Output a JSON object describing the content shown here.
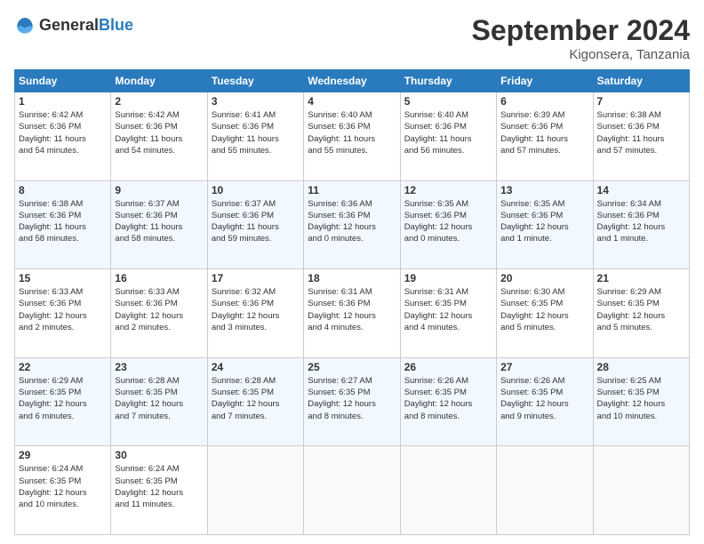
{
  "logo": {
    "general": "General",
    "blue": "Blue"
  },
  "header": {
    "month": "September 2024",
    "location": "Kigonsera, Tanzania"
  },
  "weekdays": [
    "Sunday",
    "Monday",
    "Tuesday",
    "Wednesday",
    "Thursday",
    "Friday",
    "Saturday"
  ],
  "weeks": [
    [
      {
        "day": "1",
        "info": "Sunrise: 6:42 AM\nSunset: 6:36 PM\nDaylight: 11 hours\nand 54 minutes."
      },
      {
        "day": "2",
        "info": "Sunrise: 6:42 AM\nSunset: 6:36 PM\nDaylight: 11 hours\nand 54 minutes."
      },
      {
        "day": "3",
        "info": "Sunrise: 6:41 AM\nSunset: 6:36 PM\nDaylight: 11 hours\nand 55 minutes."
      },
      {
        "day": "4",
        "info": "Sunrise: 6:40 AM\nSunset: 6:36 PM\nDaylight: 11 hours\nand 55 minutes."
      },
      {
        "day": "5",
        "info": "Sunrise: 6:40 AM\nSunset: 6:36 PM\nDaylight: 11 hours\nand 56 minutes."
      },
      {
        "day": "6",
        "info": "Sunrise: 6:39 AM\nSunset: 6:36 PM\nDaylight: 11 hours\nand 57 minutes."
      },
      {
        "day": "7",
        "info": "Sunrise: 6:38 AM\nSunset: 6:36 PM\nDaylight: 11 hours\nand 57 minutes."
      }
    ],
    [
      {
        "day": "8",
        "info": "Sunrise: 6:38 AM\nSunset: 6:36 PM\nDaylight: 11 hours\nand 58 minutes."
      },
      {
        "day": "9",
        "info": "Sunrise: 6:37 AM\nSunset: 6:36 PM\nDaylight: 11 hours\nand 58 minutes."
      },
      {
        "day": "10",
        "info": "Sunrise: 6:37 AM\nSunset: 6:36 PM\nDaylight: 11 hours\nand 59 minutes."
      },
      {
        "day": "11",
        "info": "Sunrise: 6:36 AM\nSunset: 6:36 PM\nDaylight: 12 hours\nand 0 minutes."
      },
      {
        "day": "12",
        "info": "Sunrise: 6:35 AM\nSunset: 6:36 PM\nDaylight: 12 hours\nand 0 minutes."
      },
      {
        "day": "13",
        "info": "Sunrise: 6:35 AM\nSunset: 6:36 PM\nDaylight: 12 hours\nand 1 minute."
      },
      {
        "day": "14",
        "info": "Sunrise: 6:34 AM\nSunset: 6:36 PM\nDaylight: 12 hours\nand 1 minute."
      }
    ],
    [
      {
        "day": "15",
        "info": "Sunrise: 6:33 AM\nSunset: 6:36 PM\nDaylight: 12 hours\nand 2 minutes."
      },
      {
        "day": "16",
        "info": "Sunrise: 6:33 AM\nSunset: 6:36 PM\nDaylight: 12 hours\nand 2 minutes."
      },
      {
        "day": "17",
        "info": "Sunrise: 6:32 AM\nSunset: 6:36 PM\nDaylight: 12 hours\nand 3 minutes."
      },
      {
        "day": "18",
        "info": "Sunrise: 6:31 AM\nSunset: 6:36 PM\nDaylight: 12 hours\nand 4 minutes."
      },
      {
        "day": "19",
        "info": "Sunrise: 6:31 AM\nSunset: 6:35 PM\nDaylight: 12 hours\nand 4 minutes."
      },
      {
        "day": "20",
        "info": "Sunrise: 6:30 AM\nSunset: 6:35 PM\nDaylight: 12 hours\nand 5 minutes."
      },
      {
        "day": "21",
        "info": "Sunrise: 6:29 AM\nSunset: 6:35 PM\nDaylight: 12 hours\nand 5 minutes."
      }
    ],
    [
      {
        "day": "22",
        "info": "Sunrise: 6:29 AM\nSunset: 6:35 PM\nDaylight: 12 hours\nand 6 minutes."
      },
      {
        "day": "23",
        "info": "Sunrise: 6:28 AM\nSunset: 6:35 PM\nDaylight: 12 hours\nand 7 minutes."
      },
      {
        "day": "24",
        "info": "Sunrise: 6:28 AM\nSunset: 6:35 PM\nDaylight: 12 hours\nand 7 minutes."
      },
      {
        "day": "25",
        "info": "Sunrise: 6:27 AM\nSunset: 6:35 PM\nDaylight: 12 hours\nand 8 minutes."
      },
      {
        "day": "26",
        "info": "Sunrise: 6:26 AM\nSunset: 6:35 PM\nDaylight: 12 hours\nand 8 minutes."
      },
      {
        "day": "27",
        "info": "Sunrise: 6:26 AM\nSunset: 6:35 PM\nDaylight: 12 hours\nand 9 minutes."
      },
      {
        "day": "28",
        "info": "Sunrise: 6:25 AM\nSunset: 6:35 PM\nDaylight: 12 hours\nand 10 minutes."
      }
    ],
    [
      {
        "day": "29",
        "info": "Sunrise: 6:24 AM\nSunset: 6:35 PM\nDaylight: 12 hours\nand 10 minutes."
      },
      {
        "day": "30",
        "info": "Sunrise: 6:24 AM\nSunset: 6:35 PM\nDaylight: 12 hours\nand 11 minutes."
      },
      {
        "day": "",
        "info": ""
      },
      {
        "day": "",
        "info": ""
      },
      {
        "day": "",
        "info": ""
      },
      {
        "day": "",
        "info": ""
      },
      {
        "day": "",
        "info": ""
      }
    ]
  ]
}
